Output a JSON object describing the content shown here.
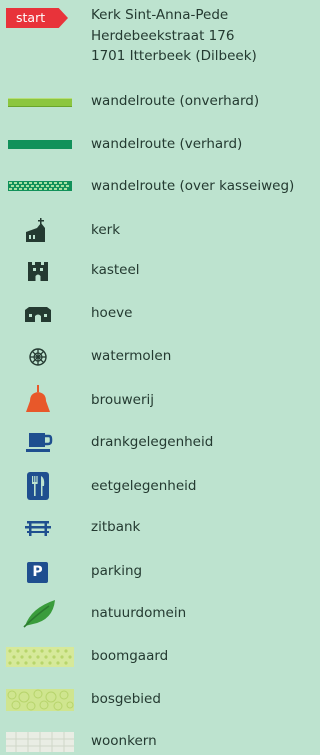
{
  "start": {
    "tag": "start",
    "address_lines": [
      "Kerk Sint-Anna-Pede",
      "Herdebeekstraat 176",
      "1701 Itterbeek (Dilbeek)"
    ]
  },
  "legend": [
    {
      "label": "wandelroute (onverhard)",
      "icon": "route-unpaved-line"
    },
    {
      "label": "wandelroute (verhard)",
      "icon": "route-paved-line"
    },
    {
      "label": "wandelroute (over kasseiweg)",
      "icon": "route-cobblestone-line"
    },
    {
      "label": "kerk",
      "icon": "church-icon"
    },
    {
      "label": "kasteel",
      "icon": "castle-icon"
    },
    {
      "label": "hoeve",
      "icon": "farm-icon"
    },
    {
      "label": "watermolen",
      "icon": "watermill-icon"
    },
    {
      "label": "brouwerij",
      "icon": "brewery-icon"
    },
    {
      "label": "drankgelegenheid",
      "icon": "cup-icon"
    },
    {
      "label": "eetgelegenheid",
      "icon": "fork-knife-icon"
    },
    {
      "label": "zitbank",
      "icon": "bench-icon"
    },
    {
      "label": "parking",
      "icon": "parking-icon",
      "text": "P"
    },
    {
      "label": "natuurdomein",
      "icon": "leaf-icon"
    },
    {
      "label": "boomgaard",
      "icon": "orchard-pattern"
    },
    {
      "label": "bosgebied",
      "icon": "forest-pattern"
    },
    {
      "label": "woonkern",
      "icon": "residential-pattern"
    }
  ],
  "colors": {
    "background": "#bde3cf",
    "accent_red": "#e8333a",
    "route_unpaved": "#8cc63f",
    "route_paved": "#11915a",
    "dark_icon": "#243a31",
    "parking_blue": "#1f4f8f",
    "brewery_orange": "#e8582a",
    "leaf_green": "#3a9c3c"
  }
}
